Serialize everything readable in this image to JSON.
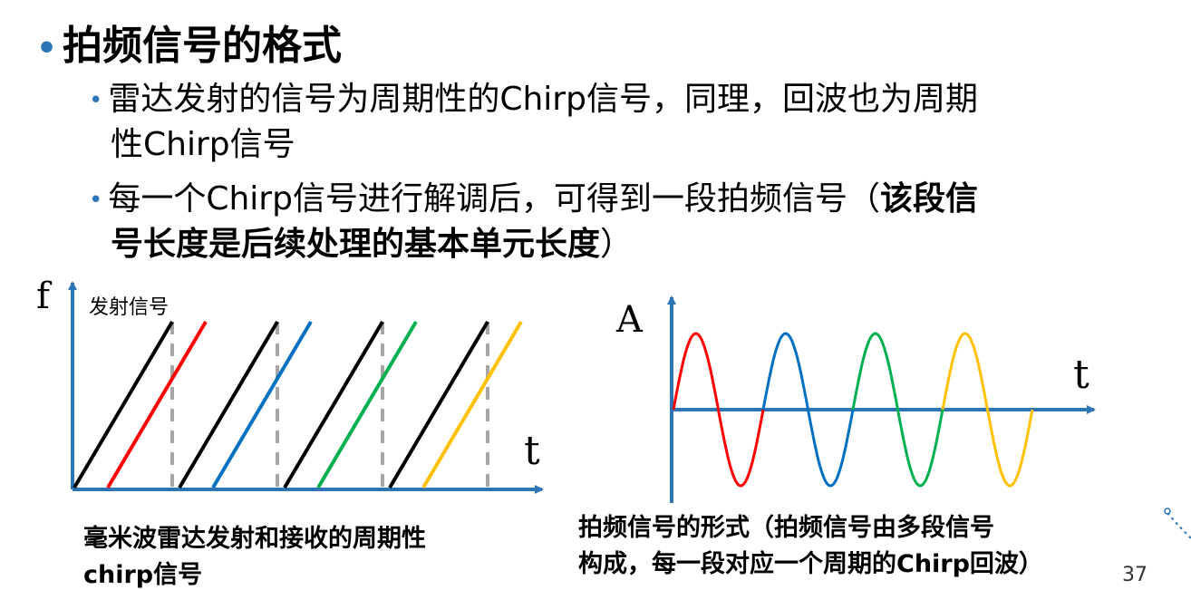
{
  "slide": {
    "title": "拍频信号的格式",
    "bullets": [
      {
        "line1": "雷达发射的信号为周期性的Chirp信号，同理，回波也为周期",
        "line2": "性Chirp信号"
      },
      {
        "line1_normal": "每一个Chirp信号进行解调后，可得到一段拍频信号（",
        "line1_bold": "该段信",
        "line2_bold": "号长度是后续处理的基本单元长度",
        "line2_normal": "）"
      }
    ],
    "page_number": "37"
  },
  "chart_data": [
    {
      "type": "diagram",
      "xlabel": "t",
      "ylabel": "f",
      "series_label": "发射信号",
      "caption_line1": "毫米波雷达发射和接收的周期性",
      "caption_line2": "chirp信号",
      "chirp_colors": [
        "#ff0000",
        "#0070C0",
        "#00B050",
        "#FFC000"
      ],
      "tx_color": "#000000",
      "periods": 4
    },
    {
      "type": "line",
      "xlabel": "t",
      "ylabel": "A",
      "caption_line1": "拍频信号的形式（拍频信号由多段信号",
      "caption_line2": "构成，每一段对应一个周期的Chirp回波）",
      "segment_colors": [
        "#ff0000",
        "#0070C0",
        "#00B050",
        "#FFC000"
      ],
      "cycles_per_segment": 1
    }
  ],
  "colors": {
    "bullet": "#2E75B6",
    "axis": "#2E75B6",
    "dashed": "#A6A6A6"
  }
}
